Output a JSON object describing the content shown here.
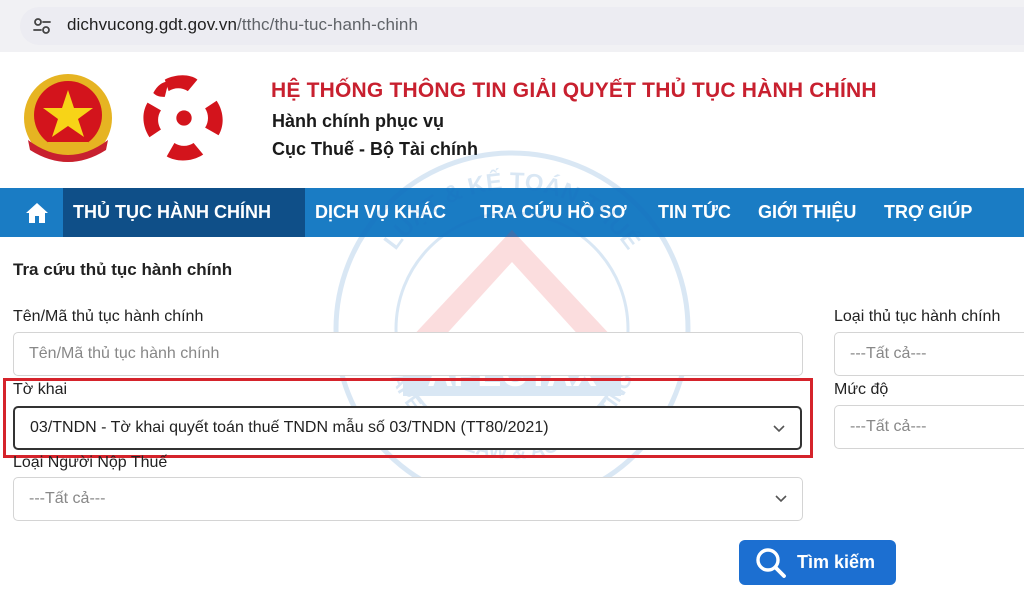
{
  "browser": {
    "url_host": "dichvucong.gdt.gov.vn",
    "url_path": "/tthc/thu-tuc-hanh-chinh"
  },
  "header": {
    "title": "HỆ THỐNG THÔNG TIN GIẢI QUYẾT THỦ TỤC HÀNH CHÍNH",
    "subtitle1": "Hành chính phục vụ",
    "subtitle2": "Cục Thuế - Bộ Tài chính"
  },
  "nav": {
    "items": [
      {
        "label": "THỦ TỤC HÀNH CHÍNH",
        "active": true
      },
      {
        "label": "DỊCH VỤ KHÁC"
      },
      {
        "label": "TRA CỨU HỒ SƠ"
      },
      {
        "label": "TIN TỨC"
      },
      {
        "label": "GIỚI THIỆU"
      },
      {
        "label": "TRỢ GIÚP"
      }
    ]
  },
  "watermark": {
    "brand": "APECTAX",
    "ring_top": "LUẬT & KẾ TOÁN THUẾ",
    "ring_bottom": "APEC TAX LAW & ACCOUNTING"
  },
  "form": {
    "section_title": "Tra cứu thủ tục hành chính",
    "name_label": "Tên/Mã thủ tục hành chính",
    "name_placeholder": "Tên/Mã thủ tục hành chính",
    "declaration_label": "Tờ khai",
    "declaration_value": "03/TNDN - Tờ khai quyết toán thuế TNDN mẫu số 03/TNDN (TT80/2021)",
    "taxpayer_label": "Loại Người Nộp Thuế",
    "taxpayer_value": "---Tất cả---",
    "type_label": "Loại thủ tục hành chính",
    "type_value": "---Tất cả---",
    "level_label": "Mức độ",
    "level_value": "---Tất cả---",
    "search_label": "Tìm kiếm"
  },
  "colors": {
    "nav_bg": "#1a7cc4",
    "nav_active": "#0f4f88",
    "title_red": "#c8202f",
    "highlight": "#d5232b",
    "button": "#1c6fd1"
  }
}
